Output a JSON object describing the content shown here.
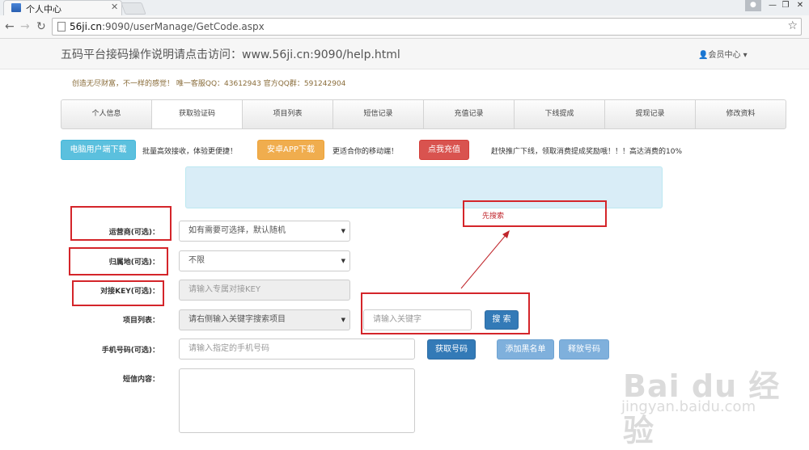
{
  "browser": {
    "tab_title": "个人中心",
    "tab_close": "✕",
    "url_host": "56ji.cn",
    "url_path": ":9090/userManage/GetCode.aspx",
    "back": "←",
    "forward": "→",
    "reload": "C",
    "star": "☆",
    "minimize": "—",
    "maximize": "❐",
    "close": "✕"
  },
  "header": {
    "title": "五码平台接码操作说明请点击访问：www.56ji.cn:9090/help.html",
    "member": "会员中心"
  },
  "subline": "创造无尽财富，不一样的感觉！ 唯一客服QQ：43612943 官方QQ群：591242904",
  "nav": {
    "tabs": [
      "个人信息",
      "获取验证码",
      "项目列表",
      "短信记录",
      "充值记录",
      "下线提成",
      "提现记录",
      "修改资料"
    ],
    "active_index": 1
  },
  "promo": {
    "pc_download": "电脑用户端下载",
    "pc_text": "批量高效接收，体验更便捷！",
    "apk_download": "安卓APP下载",
    "apk_text": "更适合你的移动端！",
    "recharge": "点我充值",
    "recharge_text": "赶快推广下线，领取消费提成奖励哦！！！高达消费的10%"
  },
  "form": {
    "carrier_label": "运营商(可选)：",
    "carrier_value": "如有需要可选择，默认随机",
    "region_label": "归属地(可选)：",
    "region_value": "不限",
    "key_label": "对接KEY(可选)：",
    "key_placeholder": "请输入专属对接KEY",
    "project_label": "项目列表：",
    "project_value": "请右侧输入关键字搜索项目",
    "keyword_placeholder": "请输入关键字",
    "search_button": "搜 索",
    "phone_label": "手机号码(可选)：",
    "phone_placeholder": "请输入指定的手机号码",
    "get_number_button": "获取号码",
    "add_blacklist_button": "添加黑名单",
    "release_button": "释放号码",
    "sms_label": "短信内容："
  },
  "annotation": {
    "search_first": "先搜索"
  },
  "watermark": {
    "brand": "Bai du 经验",
    "url": "jingyan.baidu.com"
  },
  "colors": {
    "info": "#5bc0de",
    "warning": "#f0ad4e",
    "danger": "#d9534f",
    "primary": "#337ab7",
    "annotation_red": "#d4252a"
  }
}
